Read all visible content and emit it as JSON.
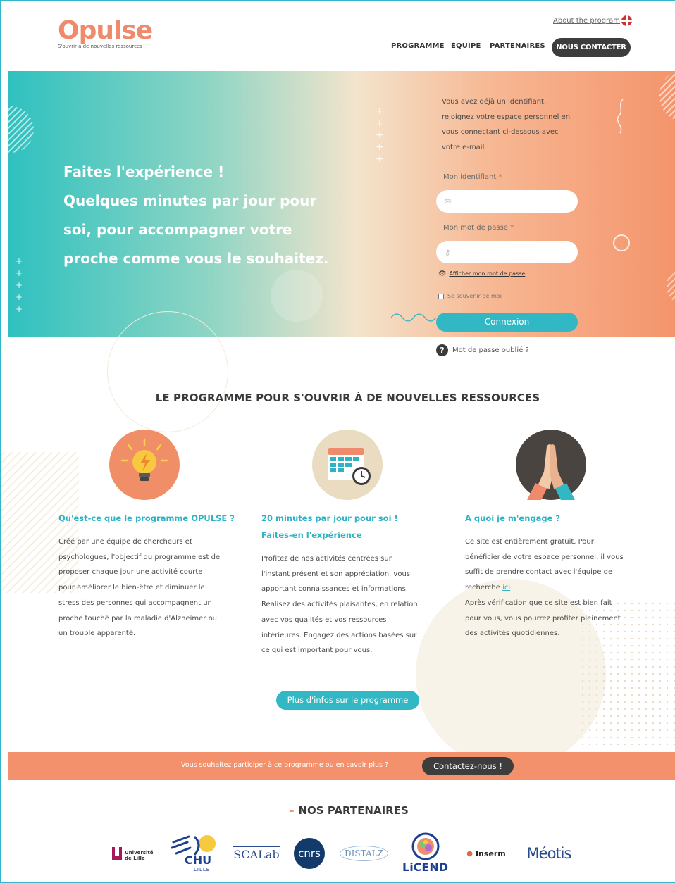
{
  "header": {
    "logo_text": "Opulse",
    "logo_tagline": "S'ouvrir à de nouvelles ressources",
    "about_link": "About the program",
    "language_icon": "uk-flag-icon",
    "nav": {
      "programme": "PROGRAMME",
      "equipe": "ÉQUIPE",
      "partenaires": "PARTENAIRES",
      "contact": "NOUS CONTACTER"
    }
  },
  "hero": {
    "title_lines": [
      "Faites l'expérience !",
      "Quelques minutes par jour pour",
      "soi, pour accompagner votre",
      "proche comme vous le souhaitez."
    ],
    "login": {
      "intro_lines": [
        "Vous avez déjà un identifiant,",
        "rejoignez votre espace personnel en",
        "vous connectant ci-dessous avec",
        "votre e-mail."
      ],
      "id_label": "Mon identifiant",
      "password_label": "Mon mot de passe",
      "required_mark": "*",
      "id_value": "",
      "password_value": "",
      "show_password": "Afficher mon mot de passe",
      "remember_me": "Se souvenir de moi",
      "submit": "Connexion",
      "forgot": "Mot de passe oublié ?"
    }
  },
  "program": {
    "title": "LE PROGRAMME POUR S'OUVRIR À DE NOUVELLES RESSOURCES",
    "columns": [
      {
        "icon": "lightbulb-icon",
        "title": "Qu'est-ce que le programme OPULSE ?",
        "text_lines": [
          "Créé par une équipe de chercheurs et",
          "psychologues, l'objectif du programme est de",
          "proposer chaque jour une activité courte",
          "pour améliorer le bien-être et diminuer le",
          "stress des personnes qui accompagnent un",
          "proche touché par la maladie d'Alzheimer ou",
          "un trouble apparenté."
        ]
      },
      {
        "icon": "calendar-clock-icon",
        "title_lines": [
          "20 minutes par jour pour soi !",
          "Faites-en l'expérience"
        ],
        "text_lines": [
          "Profitez de nos activités centrées sur",
          "l'instant présent et son appréciation, vous",
          "apportant connaissances et informations.",
          "Réalisez des activités plaisantes, en relation",
          "avec vos qualités et vos ressources",
          "intérieures. Engagez des actions basées sur",
          "ce qui est important pour vous."
        ]
      },
      {
        "icon": "hands-clasp-icon",
        "title": "A quoi je m'engage ?",
        "text_lines": [
          "Ce site est entièrement gratuit. Pour",
          "bénéficier de votre espace personnel, il vous",
          "suffit de prendre contact avec l'équipe de",
          "recherche"
        ],
        "link": "ici",
        "text_after_lines": [
          "Après vérification que ce site est bien fait",
          "pour vous, vous pourrez profiter pleinement",
          "des activités quotidiennes."
        ]
      }
    ],
    "more_button": "Plus d'infos sur le programme"
  },
  "cta": {
    "text": "Vous souhaitez participer à ce programme ou en savoir plus ?",
    "button": "Contactez-nous !"
  },
  "partners": {
    "title": "NOS PARTENAIRES",
    "dash": "–",
    "logos": {
      "lille": "Université de Lille",
      "chu": "CHU",
      "chu_sub": "LILLE",
      "scalab": "SCALab",
      "cnrs": "cnrs",
      "distalz": "DISTALZ",
      "licend": "LiCEND",
      "inserm": "Inserm",
      "meotis": "Méotis"
    }
  },
  "colors": {
    "accent_teal": "#31b8c4",
    "accent_orange": "#f2916b",
    "dark_button": "#3d3d3d"
  }
}
